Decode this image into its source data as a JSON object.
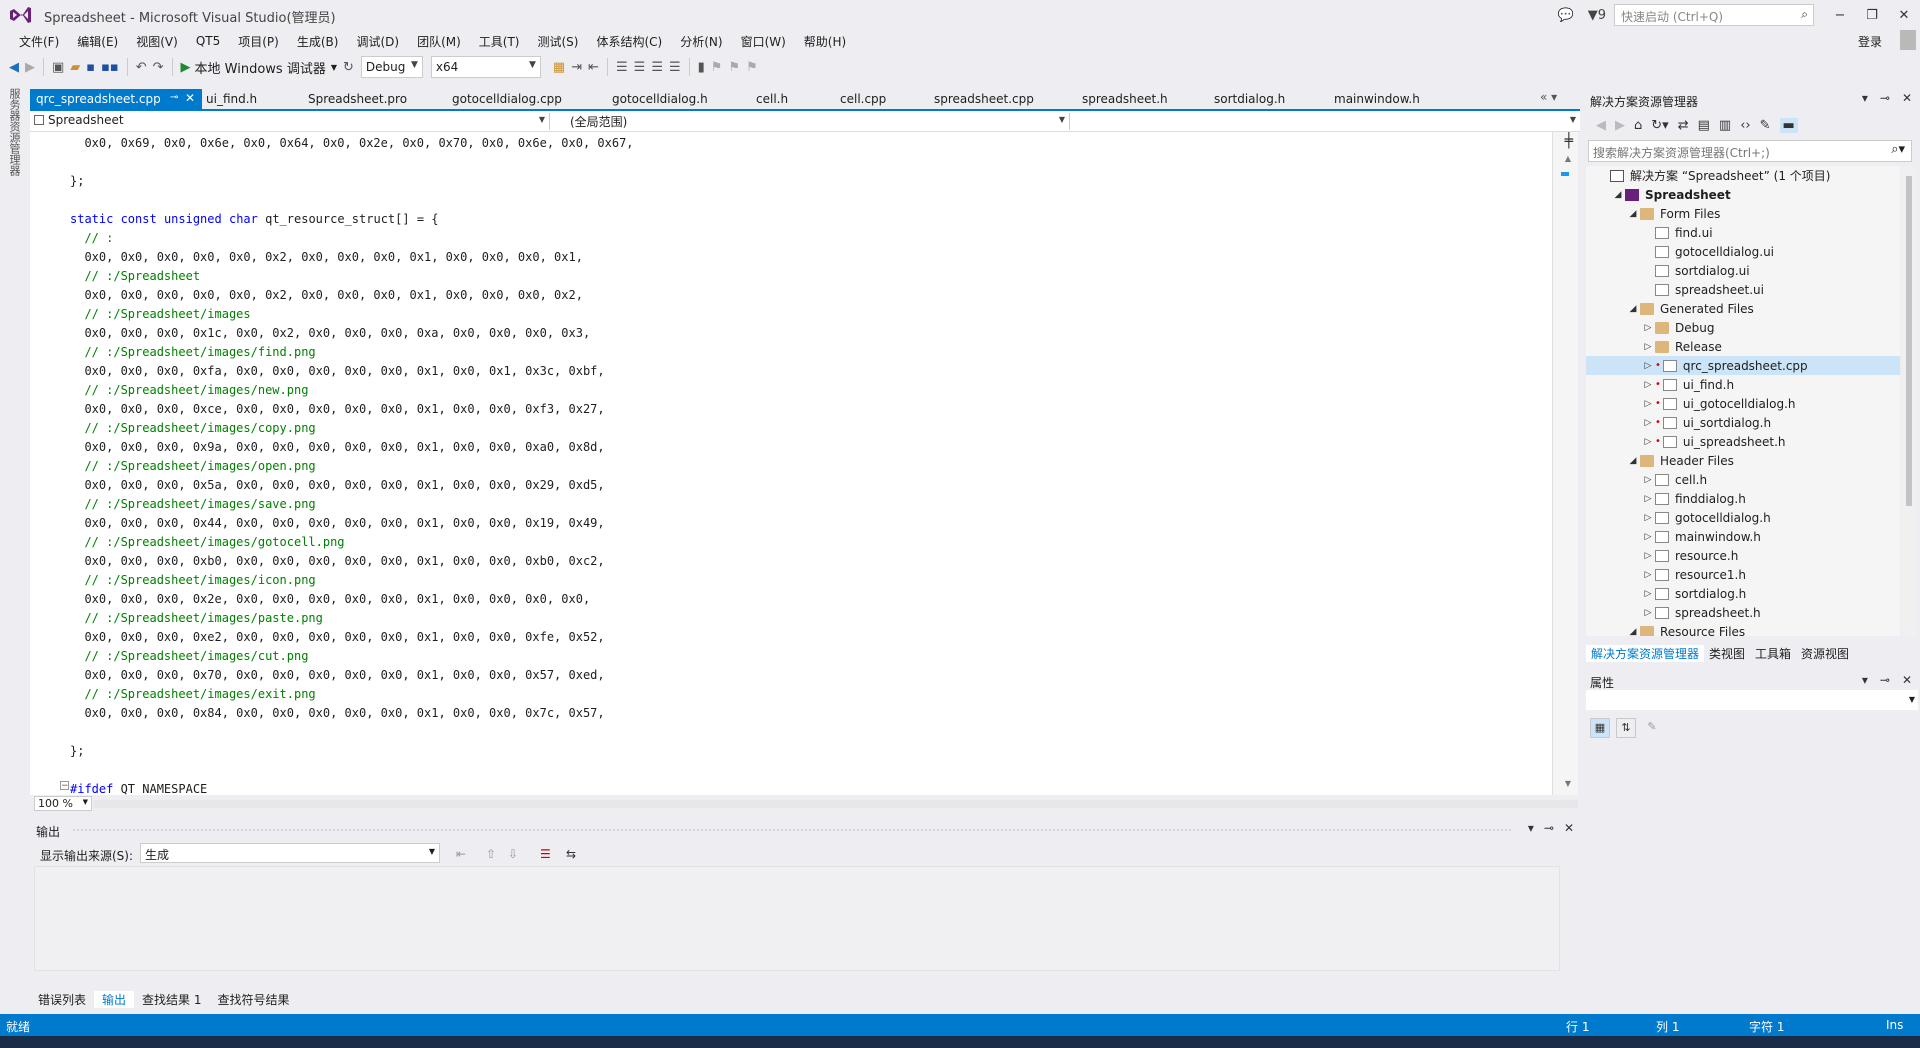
{
  "window": {
    "title": "Spreadsheet - Microsoft Visual Studio(管理员)",
    "notification_count": "9",
    "quick_launch_placeholder": "快速启动 (Ctrl+Q)",
    "login": "登录"
  },
  "menu": [
    "文件(F)",
    "编辑(E)",
    "视图(V)",
    "QT5",
    "项目(P)",
    "生成(B)",
    "调试(D)",
    "团队(M)",
    "工具(T)",
    "测试(S)",
    "体系结构(C)",
    "分析(N)",
    "窗口(W)",
    "帮助(H)"
  ],
  "toolbar": {
    "run_label": "本地 Windows 调试器",
    "config": "Debug",
    "platform": "x64"
  },
  "left_strip": {
    "server_explorer": "服务器资源管理器"
  },
  "tabs": [
    "qrc_spreadsheet.cpp",
    "ui_find.h",
    "Spreadsheet.pro",
    "gotocelldialog.cpp",
    "gotocelldialog.h",
    "cell.h",
    "cell.cpp",
    "spreadsheet.cpp",
    "spreadsheet.h",
    "sortdialog.h",
    "mainwindow.h"
  ],
  "navbar": {
    "project": "Spreadsheet",
    "scope": "(全局范围)",
    "member": ""
  },
  "code": [
    {
      "t": "  0x0, 0x69, 0x0, 0x6e, 0x0, 0x64, 0x0, 0x2e, 0x0, 0x70, 0x0, 0x6e, 0x0, 0x67,",
      "c": ""
    },
    {
      "t": "",
      "c": ""
    },
    {
      "t": "};",
      "c": ""
    },
    {
      "t": "",
      "c": ""
    },
    {
      "t": "static const unsigned char qt_resource_struct[] = {",
      "c": "decl"
    },
    {
      "t": "  // :",
      "c": "cm"
    },
    {
      "t": "  0x0, 0x0, 0x0, 0x0, 0x0, 0x2, 0x0, 0x0, 0x0, 0x1, 0x0, 0x0, 0x0, 0x1,",
      "c": ""
    },
    {
      "t": "  // :/Spreadsheet",
      "c": "cm"
    },
    {
      "t": "  0x0, 0x0, 0x0, 0x0, 0x0, 0x2, 0x0, 0x0, 0x0, 0x1, 0x0, 0x0, 0x0, 0x2,",
      "c": ""
    },
    {
      "t": "  // :/Spreadsheet/images",
      "c": "cm"
    },
    {
      "t": "  0x0, 0x0, 0x0, 0x1c, 0x0, 0x2, 0x0, 0x0, 0x0, 0xa, 0x0, 0x0, 0x0, 0x3,",
      "c": ""
    },
    {
      "t": "  // :/Spreadsheet/images/find.png",
      "c": "cm"
    },
    {
      "t": "  0x0, 0x0, 0x0, 0xfa, 0x0, 0x0, 0x0, 0x0, 0x0, 0x1, 0x0, 0x1, 0x3c, 0xbf,",
      "c": ""
    },
    {
      "t": "  // :/Spreadsheet/images/new.png",
      "c": "cm"
    },
    {
      "t": "  0x0, 0x0, 0x0, 0xce, 0x0, 0x0, 0x0, 0x0, 0x0, 0x1, 0x0, 0x0, 0xf3, 0x27,",
      "c": ""
    },
    {
      "t": "  // :/Spreadsheet/images/copy.png",
      "c": "cm"
    },
    {
      "t": "  0x0, 0x0, 0x0, 0x9a, 0x0, 0x0, 0x0, 0x0, 0x0, 0x1, 0x0, 0x0, 0xa0, 0x8d,",
      "c": ""
    },
    {
      "t": "  // :/Spreadsheet/images/open.png",
      "c": "cm"
    },
    {
      "t": "  0x0, 0x0, 0x0, 0x5a, 0x0, 0x0, 0x0, 0x0, 0x0, 0x1, 0x0, 0x0, 0x29, 0xd5,",
      "c": ""
    },
    {
      "t": "  // :/Spreadsheet/images/save.png",
      "c": "cm"
    },
    {
      "t": "  0x0, 0x0, 0x0, 0x44, 0x0, 0x0, 0x0, 0x0, 0x0, 0x1, 0x0, 0x0, 0x19, 0x49,",
      "c": ""
    },
    {
      "t": "  // :/Spreadsheet/images/gotocell.png",
      "c": "cm"
    },
    {
      "t": "  0x0, 0x0, 0x0, 0xb0, 0x0, 0x0, 0x0, 0x0, 0x0, 0x1, 0x0, 0x0, 0xb0, 0xc2,",
      "c": ""
    },
    {
      "t": "  // :/Spreadsheet/images/icon.png",
      "c": "cm"
    },
    {
      "t": "  0x0, 0x0, 0x0, 0x2e, 0x0, 0x0, 0x0, 0x0, 0x0, 0x1, 0x0, 0x0, 0x0, 0x0,",
      "c": ""
    },
    {
      "t": "  // :/Spreadsheet/images/paste.png",
      "c": "cm"
    },
    {
      "t": "  0x0, 0x0, 0x0, 0xe2, 0x0, 0x0, 0x0, 0x0, 0x0, 0x1, 0x0, 0x0, 0xfe, 0x52,",
      "c": ""
    },
    {
      "t": "  // :/Spreadsheet/images/cut.png",
      "c": "cm"
    },
    {
      "t": "  0x0, 0x0, 0x0, 0x70, 0x0, 0x0, 0x0, 0x0, 0x0, 0x1, 0x0, 0x0, 0x57, 0xed,",
      "c": ""
    },
    {
      "t": "  // :/Spreadsheet/images/exit.png",
      "c": "cm"
    },
    {
      "t": "  0x0, 0x0, 0x0, 0x84, 0x0, 0x0, 0x0, 0x0, 0x0, 0x1, 0x0, 0x0, 0x7c, 0x57,",
      "c": ""
    },
    {
      "t": "",
      "c": ""
    },
    {
      "t": "};",
      "c": ""
    },
    {
      "t": "",
      "c": ""
    },
    {
      "t": "#ifdef QT_NAMESPACE",
      "c": "pp"
    }
  ],
  "zoom": "100 %",
  "output": {
    "title": "输出",
    "source_label": "显示输出来源(S):",
    "source_value": "生成"
  },
  "bottom_tabs": [
    "错误列表",
    "输出",
    "查找结果 1",
    "查找符号结果"
  ],
  "solution_explorer": {
    "title": "解决方案资源管理器",
    "search_placeholder": "搜索解决方案资源管理器(Ctrl+;)",
    "tree": [
      {
        "label": "解决方案 “Spreadsheet” (1 个项目)",
        "kind": "solution",
        "exp": "",
        "bold": false,
        "sel": false,
        "dot": false
      },
      {
        "label": "Spreadsheet",
        "kind": "project",
        "exp": "◢",
        "bold": true,
        "sel": false,
        "dot": false
      },
      {
        "label": "Form Files",
        "kind": "folder",
        "exp": "◢",
        "bold": false,
        "sel": false,
        "dot": false
      },
      {
        "label": "find.ui",
        "kind": "file",
        "exp": "",
        "bold": false,
        "sel": false,
        "dot": false
      },
      {
        "label": "gotocelldialog.ui",
        "kind": "file",
        "exp": "",
        "bold": false,
        "sel": false,
        "dot": false
      },
      {
        "label": "sortdialog.ui",
        "kind": "file",
        "exp": "",
        "bold": false,
        "sel": false,
        "dot": false
      },
      {
        "label": "spreadsheet.ui",
        "kind": "file",
        "exp": "",
        "bold": false,
        "sel": false,
        "dot": false
      },
      {
        "label": "Generated Files",
        "kind": "folder",
        "exp": "◢",
        "bold": false,
        "sel": false,
        "dot": false
      },
      {
        "label": "Debug",
        "kind": "folder",
        "exp": "▷",
        "bold": false,
        "sel": false,
        "dot": false
      },
      {
        "label": "Release",
        "kind": "folder",
        "exp": "▷",
        "bold": false,
        "sel": false,
        "dot": false
      },
      {
        "label": "qrc_spreadsheet.cpp",
        "kind": "file",
        "exp": "▷",
        "bold": false,
        "sel": true,
        "dot": true
      },
      {
        "label": "ui_find.h",
        "kind": "file",
        "exp": "▷",
        "bold": false,
        "sel": false,
        "dot": true
      },
      {
        "label": "ui_gotocelldialog.h",
        "kind": "file",
        "exp": "▷",
        "bold": false,
        "sel": false,
        "dot": true
      },
      {
        "label": "ui_sortdialog.h",
        "kind": "file",
        "exp": "▷",
        "bold": false,
        "sel": false,
        "dot": true
      },
      {
        "label": "ui_spreadsheet.h",
        "kind": "file",
        "exp": "▷",
        "bold": false,
        "sel": false,
        "dot": true
      },
      {
        "label": "Header Files",
        "kind": "folder",
        "exp": "◢",
        "bold": false,
        "sel": false,
        "dot": false
      },
      {
        "label": "cell.h",
        "kind": "file",
        "exp": "▷",
        "bold": false,
        "sel": false,
        "dot": false
      },
      {
        "label": "finddialog.h",
        "kind": "file",
        "exp": "▷",
        "bold": false,
        "sel": false,
        "dot": false
      },
      {
        "label": "gotocelldialog.h",
        "kind": "file",
        "exp": "▷",
        "bold": false,
        "sel": false,
        "dot": false
      },
      {
        "label": "mainwindow.h",
        "kind": "file",
        "exp": "▷",
        "bold": false,
        "sel": false,
        "dot": false
      },
      {
        "label": "resource.h",
        "kind": "file",
        "exp": "▷",
        "bold": false,
        "sel": false,
        "dot": false
      },
      {
        "label": "resource1.h",
        "kind": "file",
        "exp": "▷",
        "bold": false,
        "sel": false,
        "dot": false
      },
      {
        "label": "sortdialog.h",
        "kind": "file",
        "exp": "▷",
        "bold": false,
        "sel": false,
        "dot": false
      },
      {
        "label": "spreadsheet.h",
        "kind": "file",
        "exp": "▷",
        "bold": false,
        "sel": false,
        "dot": false
      },
      {
        "label": "Resource Files",
        "kind": "folder",
        "exp": "◢",
        "bold": false,
        "sel": false,
        "dot": false
      }
    ],
    "tree_indent_levels": [
      0,
      1,
      2,
      3,
      3,
      3,
      3,
      2,
      3,
      3,
      3,
      3,
      3,
      3,
      3,
      2,
      3,
      3,
      3,
      3,
      3,
      3,
      3,
      3,
      2
    ]
  },
  "panel_tabs": [
    "解决方案资源管理器",
    "类视图",
    "工具箱",
    "资源视图"
  ],
  "properties": {
    "title": "属性"
  },
  "status": {
    "left": "就绪",
    "row": "行 1",
    "col": "列 1",
    "char": "字符 1",
    "mode": "Ins"
  },
  "colors": {
    "accent": "#007acc",
    "comment": "#008000",
    "keyword": "#0000ff",
    "selection": "#cce4f7"
  }
}
